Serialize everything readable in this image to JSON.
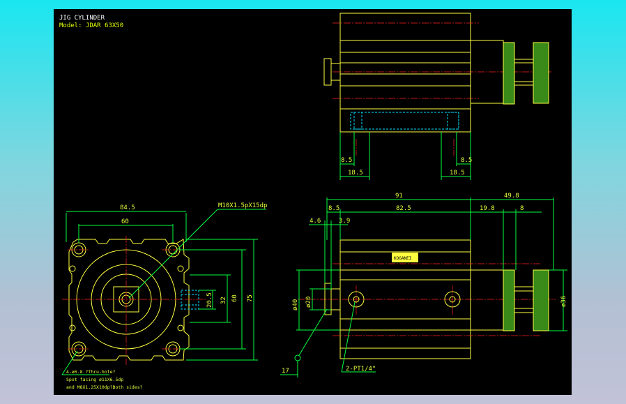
{
  "title": "JIG CYLINDER",
  "model": "Model: JDAR 63X50",
  "front_view": {
    "dims": {
      "width_outer": "84.5",
      "width_holes": "60",
      "height_holes": "60",
      "height_outer": "75",
      "port_center": "32",
      "port_width": "20.5"
    },
    "thread_note": "M10X1.5pX15dp",
    "hole_note": {
      "line1": "4-ø6.8 ?Thru-hole?",
      "line2": "Spot facing ø11X6.5dp",
      "line3": "and M8X1.25X10dp?Both sides?"
    }
  },
  "top_view": {
    "dims": {
      "left_small": "8.5",
      "left_wide": "18.5",
      "right_small": "8.5",
      "right_wide": "18.5"
    }
  },
  "side_view": {
    "dims": {
      "body_length": "91",
      "protrusion": "49.8",
      "start_offset": "8.5",
      "port_spacing": "82.5",
      "cap_width": "19.8",
      "knob_width": "8",
      "rod_end": "4.6",
      "boss": "3.9",
      "rod_dia": "ø20",
      "body_dia": "ø40",
      "knob_dia": "ø36",
      "tip": "17"
    },
    "port_note": "2-PT1/4\"",
    "label_plate": "KOGANEI"
  },
  "colors": {
    "line": "#00ff40",
    "body": "#ffff40",
    "center": "#ff2020",
    "hidden": "#00e0ff",
    "text": "#e6ff3c"
  }
}
